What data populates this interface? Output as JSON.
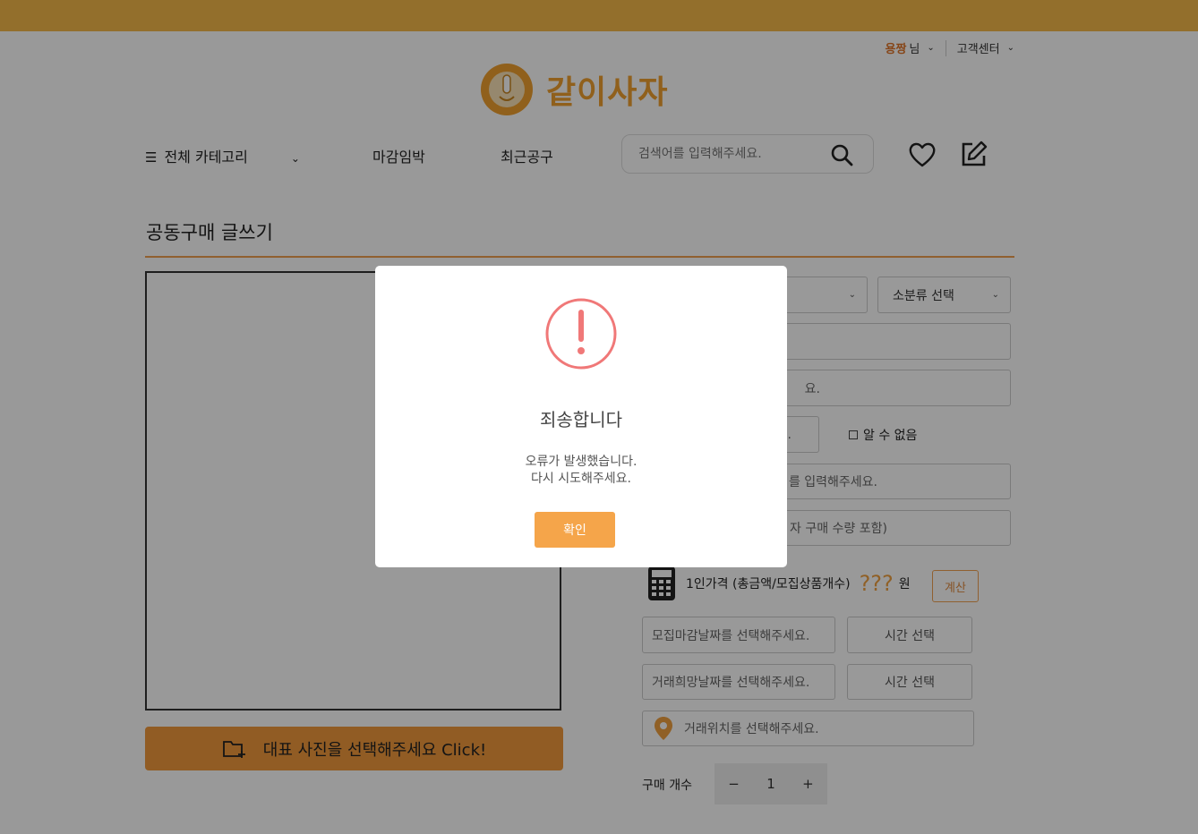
{
  "header": {
    "user_name": "용짱",
    "user_suffix": "님",
    "customer_center": "고객센터",
    "logo_text": "같이사자"
  },
  "nav": {
    "all_categories": "전체 카테고리",
    "deadline_soon": "마감임박",
    "recent_groupbuy": "최근공구",
    "search_placeholder": "검색어를 입력해주세요."
  },
  "page": {
    "title": "공동구매 글쓰기",
    "photo_button": "대표 사진을 선택해주세요 Click!"
  },
  "form": {
    "subcategory": "소분류 선택",
    "field3_tail": "요.",
    "field4_tail": ".",
    "unknown_label": "알 수 없음",
    "field5_tail": "를 입력해주세요.",
    "field6_tail": "자 구매 수량 포함)",
    "price_label": "1인가격 (총금액/모집상품개수)",
    "price_value": "???",
    "price_unit": "원",
    "calc_button": "계산",
    "deadline_date": "모집마감날짜를 선택해주세요.",
    "deadline_time": "시간 선택",
    "trade_date": "거래희망날짜를 선택해주세요.",
    "trade_time": "시간 선택",
    "location": "거래위치를 선택해주세요.",
    "qty_label": "구매 개수",
    "qty_minus": "−",
    "qty_value": "1",
    "qty_plus": "+"
  },
  "modal": {
    "title": "죄송합니다",
    "message_line1": "오류가 발생했습니다.",
    "message_line2": "다시 시도해주세요.",
    "confirm": "확인"
  },
  "colors": {
    "brand": "#f5b94a",
    "accent": "#f29a3d",
    "warn": "#f07878"
  }
}
